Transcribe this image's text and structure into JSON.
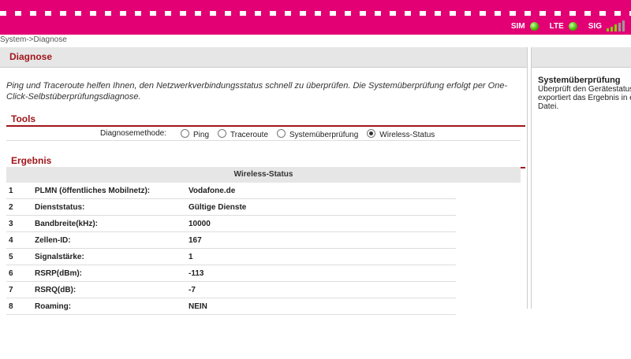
{
  "header": {
    "status": {
      "sim_label": "SIM",
      "lte_label": "LTE",
      "sig_label": "SIG",
      "signal_level": 3,
      "signal_max": 5
    },
    "colors": {
      "brand": "#e20074",
      "accent": "#a0161b",
      "led_on": "#44b400"
    }
  },
  "breadcrumb": "System->Diagnose",
  "main": {
    "title": "Diagnose",
    "description": "Ping und Traceroute helfen Ihnen, den Netzwerkverbindungsstatus schnell zu überprüfen. Die Systemüberprüfung erfolgt per One-Click-Selbstüberprüfungsdiagnose.",
    "tools": {
      "heading": "Tools",
      "method_label": "Diagnosemethode:",
      "options": [
        "Ping",
        "Traceroute",
        "Systemüberprüfung",
        "Wireless-Status"
      ],
      "selected_index": 3
    },
    "result": {
      "heading": "Ergebnis",
      "table_title": "Wireless-Status",
      "rows": [
        {
          "n": "1",
          "key": "PLMN (öffentliches Mobilnetz):",
          "value": "Vodafone.de"
        },
        {
          "n": "2",
          "key": "Dienststatus:",
          "value": "Gültige Dienste"
        },
        {
          "n": "3",
          "key": "Bandbreite(kHz):",
          "value": "10000"
        },
        {
          "n": "4",
          "key": "Zellen-ID:",
          "value": "167"
        },
        {
          "n": "5",
          "key": "Signalstärke:",
          "value": "1"
        },
        {
          "n": "6",
          "key": "RSRP(dBm):",
          "value": "-113"
        },
        {
          "n": "7",
          "key": "RSRQ(dB):",
          "value": "-7"
        },
        {
          "n": "8",
          "key": "Roaming:",
          "value": "NEIN"
        }
      ]
    }
  },
  "side": {
    "heading": "Systemüberprüfung",
    "lines": [
      "Überprüft den Gerätestatus",
      "exportiert das Ergebnis in e",
      "Datei."
    ]
  }
}
